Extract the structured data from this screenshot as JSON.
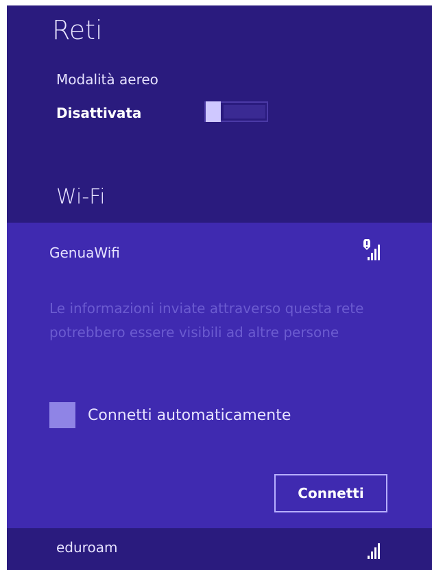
{
  "panel": {
    "title": "Reti",
    "airplane_mode": {
      "label": "Modalità aereo",
      "state": "Disattivata",
      "on": false
    },
    "wifi_heading": "Wi-Fi"
  },
  "networks": [
    {
      "name": "GenuaWifi",
      "signal_icon": "wifi-signal-warning-icon",
      "warning": "Le informazioni inviate attraverso questa rete potrebbero essere visibili ad altre persone",
      "auto_connect_label": "Connetti automaticamente",
      "auto_connect_checked": false,
      "connect_button": "Connetti",
      "selected": true
    },
    {
      "name": "eduroam",
      "signal_icon": "wifi-signal-icon",
      "selected": false
    }
  ],
  "colors": {
    "panel_bg": "#2a1b7e",
    "selected_bg": "#3f2ab0",
    "text": "#e6e2ff",
    "muted_text": "#6b5bd0",
    "toggle_thumb": "#cfc8ff",
    "checkbox": "#8f84e6"
  }
}
